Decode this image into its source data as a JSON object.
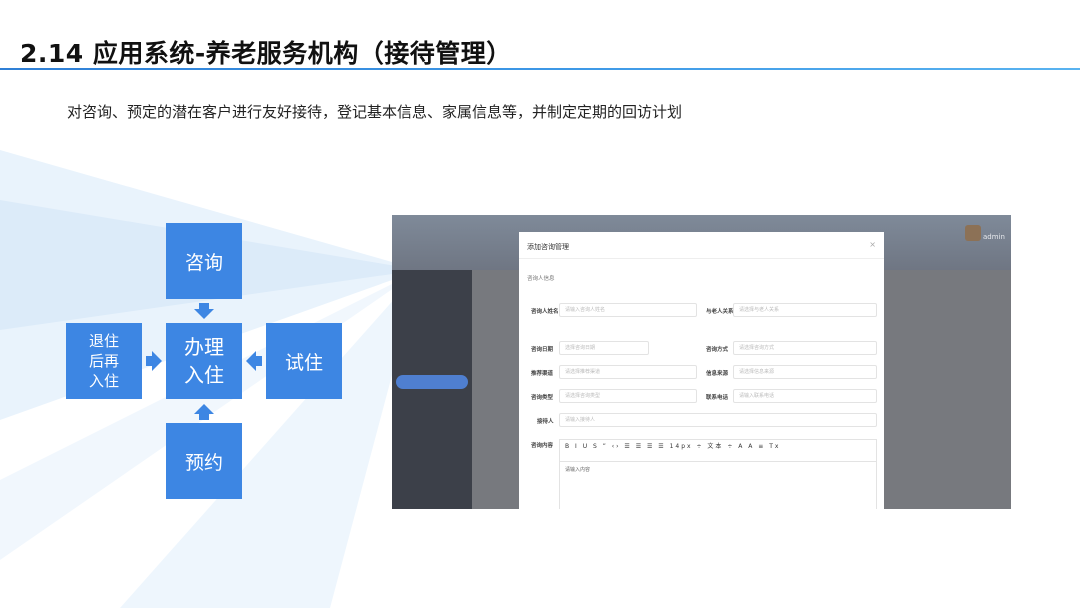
{
  "slide": {
    "title": "2.14 应用系统-养老服务机构（接待管理）",
    "subtitle": "对咨询、预定的潜在客户进行友好接待，登记基本信息、家属信息等，并制定定期的回访计划"
  },
  "flow": {
    "top": "咨询",
    "center_line1": "办理",
    "center_line2": "入住",
    "left_line1": "退住",
    "left_line2": "后再",
    "left_line3": "入住",
    "right": "试住",
    "bottom": "预约"
  },
  "colors": {
    "box": "#3d86e3",
    "accent_rule": "#3c97e6"
  },
  "screenshot": {
    "admin_label": "admin",
    "modal": {
      "title": "添加咨询管理",
      "close": "×",
      "section": "咨询人信息",
      "fields": {
        "consultant_name_label": "咨询人姓名",
        "consultant_name_placeholder": "请输入咨询人姓名",
        "relation_label": "与老人关系",
        "relation_placeholder": "请选择与老人关系",
        "date_label": "咨询日期",
        "date_placeholder": "选择咨询日期",
        "method_label": "咨询方式",
        "method_placeholder": "请选择咨询方式",
        "channel_label": "推荐渠道",
        "channel_placeholder": "请选择推荐渠道",
        "source_label": "信息来源",
        "source_placeholder": "请选择信息来源",
        "type_label": "咨询类型",
        "type_placeholder": "请选择咨询类型",
        "phone_label": "联系电话",
        "phone_placeholder": "请输入联系电话",
        "receiver_label": "接待人",
        "receiver_placeholder": "请输入接待人",
        "content_label": "咨询内容"
      },
      "toolbar": "B I U S ” ‹› ☰ ☰ ☰ ☰ 14px ÷ 文本 ÷ A A ≡ Tx",
      "editor_placeholder": "请输入内容"
    }
  }
}
